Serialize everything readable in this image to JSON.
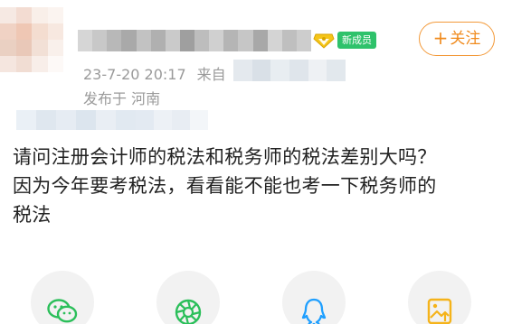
{
  "post": {
    "badge_label": "新成员",
    "follow_label": "关注",
    "timestamp": "23-7-20 20:17",
    "from_label": "来自",
    "location": "发布于 河南",
    "body_lines": [
      "请问注册会计师的税法和税务师的税法差别大吗？",
      "因为今年要考税法，看看能不能也考一下税务师的",
      "税法"
    ]
  },
  "share": {
    "icons": [
      "wechat-icon",
      "moments-icon",
      "qq-icon",
      "save-image-icon"
    ]
  },
  "colors": {
    "accent_orange": "#f08a1c",
    "badge_green": "#2fc26b",
    "wechat_green": "#2bbf5a",
    "qq_blue": "#1e9fff",
    "save_yellow": "#f5b31a"
  }
}
